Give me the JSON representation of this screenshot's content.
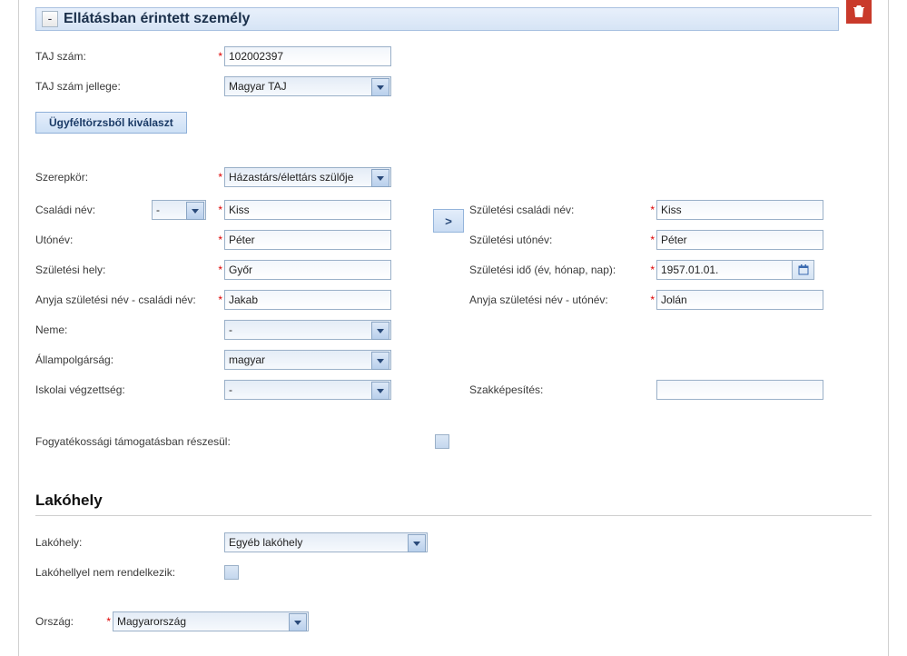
{
  "section": {
    "title": "Ellátásban érintett személy",
    "collapse_symbol": "-"
  },
  "labels": {
    "taj_szam": "TAJ szám:",
    "taj_szam_jellege": "TAJ szám jellege:",
    "ugyfeltorzsbol": "Ügyféltörzsből kiválaszt",
    "szerepkor": "Szerepkör:",
    "csaladi_nev": "Családi név:",
    "utonev": "Utónév:",
    "szul_hely": "Születési hely:",
    "anyja_csaladi": "Anyja születési név - családi név:",
    "neme": "Neme:",
    "allampolgarsag": "Állampolgárság:",
    "iskolai": "Iskolai végzettség:",
    "szul_csaladi_nev": "Születési családi név:",
    "szul_utonev": "Születési utónév:",
    "szul_ido": "Születési idő (év, hónap, nap):",
    "anyja_utonev": "Anyja születési név - utónév:",
    "szakkepesites": "Szakképesítés:",
    "fogyatekossagi": "Fogyatékossági támogatásban részesül:",
    "transfer": ">",
    "lakohely_heading": "Lakóhely",
    "lakohely": "Lakóhely:",
    "lakohellyel_nem": "Lakóhellyel nem rendelkezik:",
    "orszag": "Ország:"
  },
  "values": {
    "taj_szam": "102002397",
    "taj_szam_jellege": "Magyar TAJ",
    "szerepkor": "Házastárs/élettárs szülője",
    "prefix": "-",
    "csaladi_nev": "Kiss",
    "utonev": "Péter",
    "szul_hely": "Győr",
    "anyja_csaladi": "Jakab",
    "neme": "-",
    "allampolgarsag": "magyar",
    "iskolai": "-",
    "szul_csaladi_nev": "Kiss",
    "szul_utonev": "Péter",
    "szul_ido": "1957.01.01.",
    "anyja_utonev": "Jolán",
    "szakkepesites": "",
    "lakohely": "Egyéb lakóhely",
    "orszag": "Magyarország"
  }
}
